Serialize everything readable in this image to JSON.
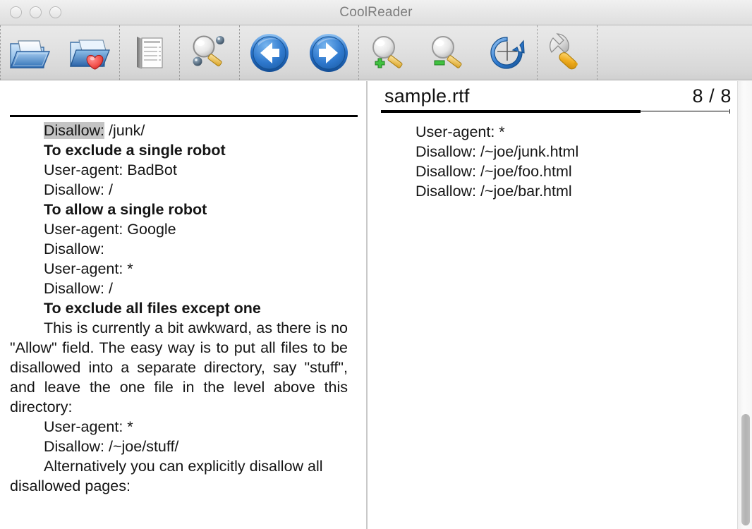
{
  "window": {
    "title": "CoolReader",
    "controls": [
      {
        "name": "close",
        "label": ""
      },
      {
        "name": "minimize",
        "label": ""
      },
      {
        "name": "zoom",
        "label": ""
      }
    ]
  },
  "toolbar": {
    "groups": [
      {
        "name": "file",
        "buttons": [
          {
            "icon": "open-folder-icon",
            "label": "Open file"
          },
          {
            "icon": "favorites-folder-heart-icon",
            "label": "Open recent book"
          }
        ]
      },
      {
        "name": "navigation",
        "buttons": [
          {
            "icon": "table-of-contents-icon",
            "label": "Table of contents"
          }
        ]
      },
      {
        "name": "search",
        "buttons": [
          {
            "icon": "search-magnifier-icon",
            "label": "Find text"
          }
        ]
      },
      {
        "name": "history",
        "buttons": [
          {
            "icon": "arrow-back-icon",
            "label": "Back"
          },
          {
            "icon": "arrow-forward-icon",
            "label": "Forward"
          }
        ]
      },
      {
        "name": "zoom",
        "buttons": [
          {
            "icon": "zoom-in-icon",
            "label": "Increase font size"
          },
          {
            "icon": "zoom-out-icon",
            "label": "Decrease font size"
          },
          {
            "icon": "rotate-icon",
            "label": "Rotate"
          }
        ]
      },
      {
        "name": "settings",
        "buttons": [
          {
            "icon": "wrench-settings-icon",
            "label": "Settings"
          }
        ]
      }
    ]
  },
  "left_pane": {
    "lines": [
      {
        "style": "indent",
        "pre": "",
        "highlight": "Disallow:",
        "post": " /junk/"
      },
      {
        "style": "heading",
        "text": "To exclude a single robot"
      },
      {
        "style": "indent",
        "text": "User-agent: BadBot"
      },
      {
        "style": "indent",
        "text": "Disallow: /"
      },
      {
        "style": "heading",
        "text": "To allow a single robot"
      },
      {
        "style": "indent",
        "text": "User-agent: Google"
      },
      {
        "style": "indent",
        "text": "Disallow:"
      },
      {
        "style": "indent",
        "text": "User-agent: *"
      },
      {
        "style": "indent",
        "text": "Disallow: /"
      },
      {
        "style": "heading",
        "text": "To exclude all files except one"
      },
      {
        "style": "para",
        "text": "This is currently a bit awkward, as there is no \"Allow\" field. The easy way is to put all files to be disallowed into a separate directory, say \"stuff\", and leave the one file in the level above this directory:"
      },
      {
        "style": "indent",
        "text": "User-agent: *"
      },
      {
        "style": "indent",
        "text": "Disallow: /~joe/stuff/"
      },
      {
        "style": "para-last",
        "text": "Alternatively you can explicitly disallow all disallowed pages:"
      }
    ]
  },
  "right_pane": {
    "header": {
      "filename": "sample.rtf",
      "page_indicator": "8 / 8",
      "progress_percent": 74
    },
    "lines": [
      "User-agent: *",
      "Disallow: /~joe/junk.html",
      "Disallow: /~joe/foo.html",
      "Disallow: /~joe/bar.html"
    ]
  },
  "colors": {
    "highlight": "#c4c4c4",
    "text": "#151515",
    "title_text": "#7d7d7d",
    "rule": "#000000"
  }
}
